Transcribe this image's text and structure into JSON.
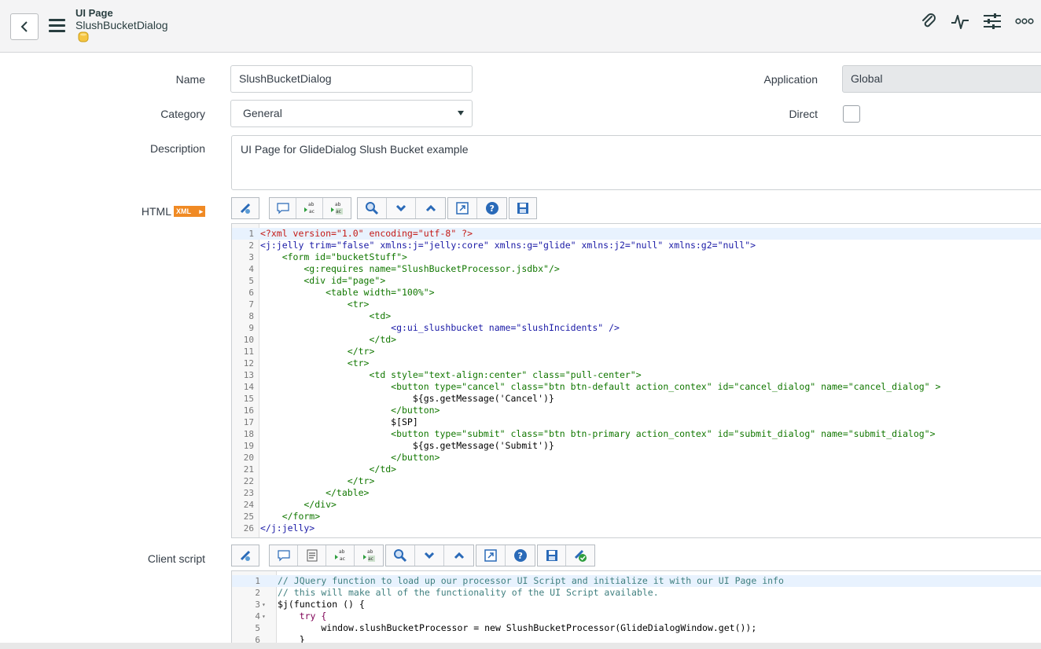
{
  "header": {
    "title": "UI Page",
    "subtitle": "SlushBucketDialog",
    "icons": [
      "paperclip-icon",
      "activity-icon",
      "sliders-icon",
      "more-icon"
    ]
  },
  "form": {
    "name_label": "Name",
    "name_value": "SlushBucketDialog",
    "category_label": "Category",
    "category_value": "General",
    "description_label": "Description",
    "description_value": "UI Page for GlideDialog Slush Bucket example",
    "application_label": "Application",
    "application_value": "Global",
    "direct_label": "Direct",
    "html_label": "HTML",
    "xml_badge": "XML",
    "client_script_label": "Client script"
  },
  "html_code": [
    {
      "n": "1",
      "t": "<?xml version=\"1.0\" encoding=\"utf-8\" ?>",
      "c": "#c41a16"
    },
    {
      "n": "2",
      "t": "<j:jelly trim=\"false\" xmlns:j=\"jelly:core\" xmlns:g=\"glide\" xmlns:j2=\"null\" xmlns:g2=\"null\">",
      "c": "#1a1aa6"
    },
    {
      "n": "3",
      "t": "    <form id=\"bucketStuff\">",
      "c": "#170"
    },
    {
      "n": "4",
      "t": "        <g:requires name=\"SlushBucketProcessor.jsdbx\"/>",
      "c": "#170"
    },
    {
      "n": "5",
      "t": "        <div id=\"page\">",
      "c": "#170"
    },
    {
      "n": "6",
      "t": "            <table width=\"100%\">",
      "c": "#170"
    },
    {
      "n": "7",
      "t": "                <tr>",
      "c": "#170"
    },
    {
      "n": "8",
      "t": "                    <td>",
      "c": "#170"
    },
    {
      "n": "9",
      "t": "                        <g:ui_slushbucket name=\"slushIncidents\" />",
      "c": "#1a1aa6"
    },
    {
      "n": "10",
      "t": "                    </td>",
      "c": "#170"
    },
    {
      "n": "11",
      "t": "                </tr>",
      "c": "#170"
    },
    {
      "n": "12",
      "t": "                <tr>",
      "c": "#170"
    },
    {
      "n": "13",
      "t": "                    <td style=\"text-align:center\" class=\"pull-center\">",
      "c": "#170"
    },
    {
      "n": "14",
      "t": "                        <button type=\"cancel\" class=\"btn btn-default action_contex\" id=\"cancel_dialog\" name=\"cancel_dialog\" >",
      "c": "#170"
    },
    {
      "n": "15",
      "t": "                            ${gs.getMessage('Cancel')}",
      "c": "#000"
    },
    {
      "n": "16",
      "t": "                        </button>",
      "c": "#170"
    },
    {
      "n": "17",
      "t": "                        $[SP]",
      "c": "#000"
    },
    {
      "n": "18",
      "t": "                        <button type=\"submit\" class=\"btn btn-primary action_contex\" id=\"submit_dialog\" name=\"submit_dialog\">",
      "c": "#170"
    },
    {
      "n": "19",
      "t": "                            ${gs.getMessage('Submit')}",
      "c": "#000"
    },
    {
      "n": "20",
      "t": "                        </button>",
      "c": "#170"
    },
    {
      "n": "21",
      "t": "                    </td>",
      "c": "#170"
    },
    {
      "n": "22",
      "t": "                </tr>",
      "c": "#170"
    },
    {
      "n": "23",
      "t": "            </table>",
      "c": "#170"
    },
    {
      "n": "24",
      "t": "        </div>",
      "c": "#170"
    },
    {
      "n": "25",
      "t": "    </form>",
      "c": "#170"
    },
    {
      "n": "26",
      "t": "</j:jelly>",
      "c": "#1a1aa6"
    }
  ],
  "client_code": [
    {
      "n": "1",
      "t": "// JQuery function to load up our processor UI Script and initialize it with our UI Page info",
      "c": "#3f7f7f"
    },
    {
      "n": "2",
      "t": "// this will make all of the functionality of the UI Script available.",
      "c": "#3f7f7f"
    },
    {
      "n": "3",
      "f": "▾",
      "t": "$j(function () {",
      "c": "#000"
    },
    {
      "n": "4",
      "f": "▾",
      "t": "    try {",
      "c": "#7f0055"
    },
    {
      "n": "5",
      "t": "        window.slushBucketProcessor = new SlushBucketProcessor(GlideDialogWindow.get());",
      "c": "#000"
    },
    {
      "n": "6",
      "t": "    }",
      "c": "#000"
    }
  ]
}
